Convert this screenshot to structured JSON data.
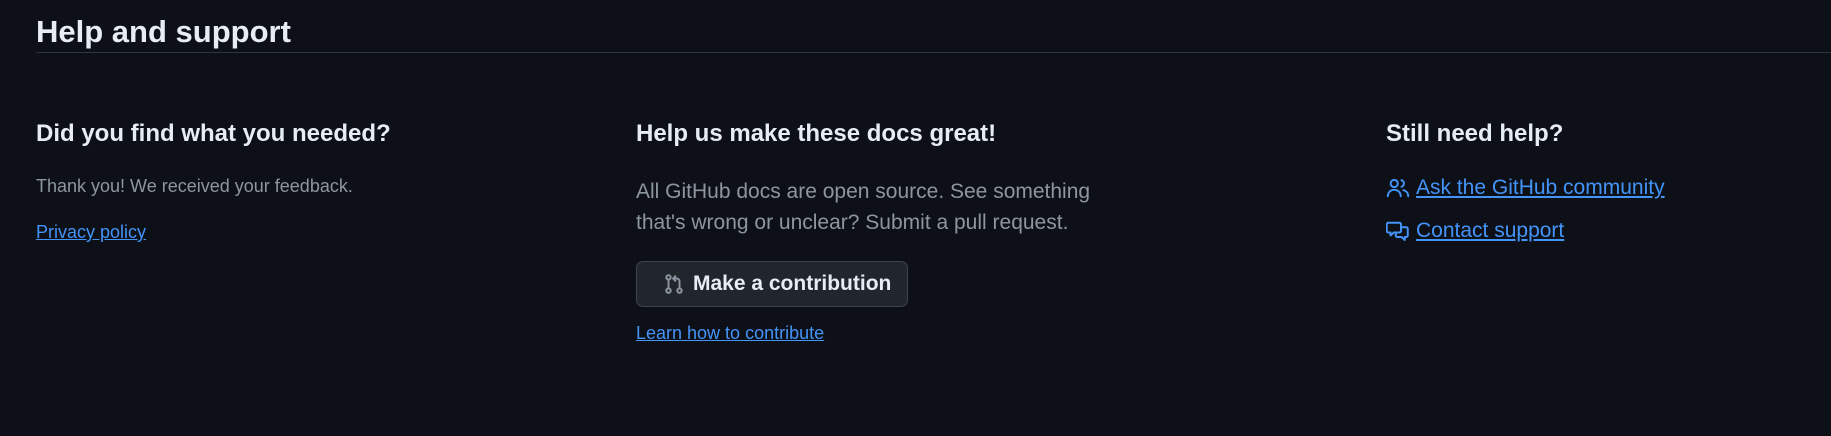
{
  "section": {
    "title": "Help and support"
  },
  "feedback": {
    "heading": "Did you find what you needed?",
    "message": "Thank you! We received your feedback.",
    "privacy_link": "Privacy policy"
  },
  "contribute": {
    "heading": "Help us make these docs great!",
    "description": "All GitHub docs are open source. See something that's wrong or unclear? Submit a pull request.",
    "button_label": "Make a contribution",
    "button_icon": "git-pull-request-icon",
    "learn_link": "Learn how to contribute"
  },
  "support": {
    "heading": "Still need help?",
    "links": [
      {
        "label": "Ask the GitHub community",
        "icon": "people-icon"
      },
      {
        "label": "Contact support",
        "icon": "comment-discussion-icon"
      }
    ]
  },
  "colors": {
    "background": "#0d1117",
    "text_primary": "#e6edf3",
    "text_muted": "#8d96a0",
    "link": "#4493f8",
    "button_bg": "#21262d",
    "border": "#30363d"
  }
}
